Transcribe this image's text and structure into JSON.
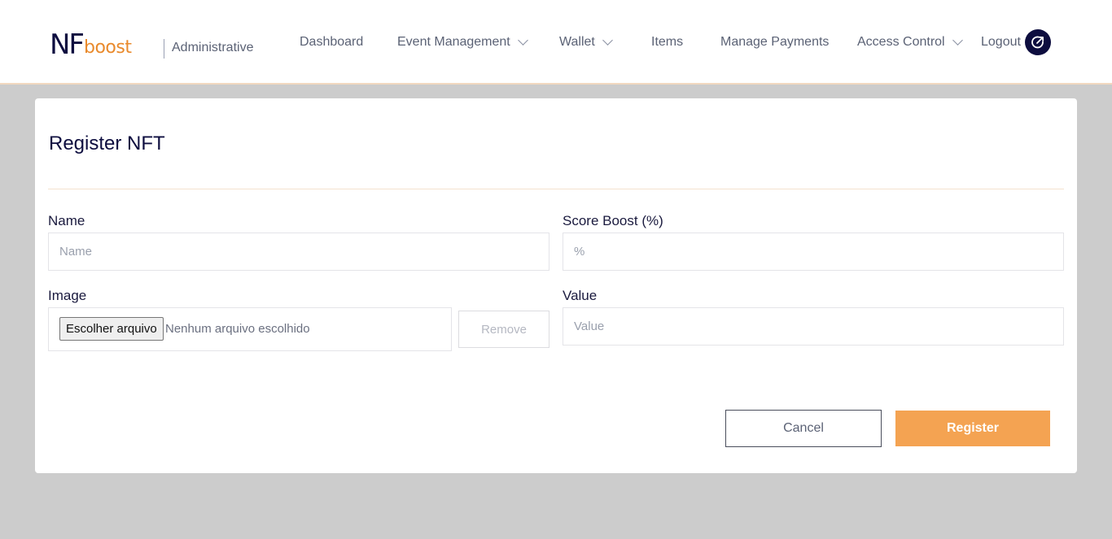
{
  "header": {
    "logo_nf": "NF",
    "logo_boost": "boost",
    "subtitle": "Administrative",
    "nav": [
      {
        "label": "Dashboard"
      },
      {
        "label": "Event Management"
      },
      {
        "label": "Wallet"
      },
      {
        "label": "Items"
      },
      {
        "label": "Manage Payments"
      },
      {
        "label": "Access Control"
      },
      {
        "label": "Logout"
      }
    ]
  },
  "form": {
    "title": "Register NFT",
    "name": {
      "label": "Name",
      "placeholder": "Name",
      "value": ""
    },
    "score_boost": {
      "label": "Score Boost (%)",
      "placeholder": "%",
      "value": ""
    },
    "image": {
      "label": "Image",
      "choose_label": "Escolher arquivo",
      "status": "Nenhum arquivo escolhido",
      "remove_label": "Remove"
    },
    "value": {
      "label": "Value",
      "placeholder": "Value",
      "value": ""
    },
    "cancel_label": "Cancel",
    "register_label": "Register"
  },
  "colors": {
    "brand_navy": "#0d0d3f",
    "brand_orange": "#e98a2c",
    "primary_button": "#f4a352",
    "page_background": "#cccccc"
  },
  "icons": {
    "dropdown": "chevron-down-icon",
    "logout": "logout-icon"
  }
}
